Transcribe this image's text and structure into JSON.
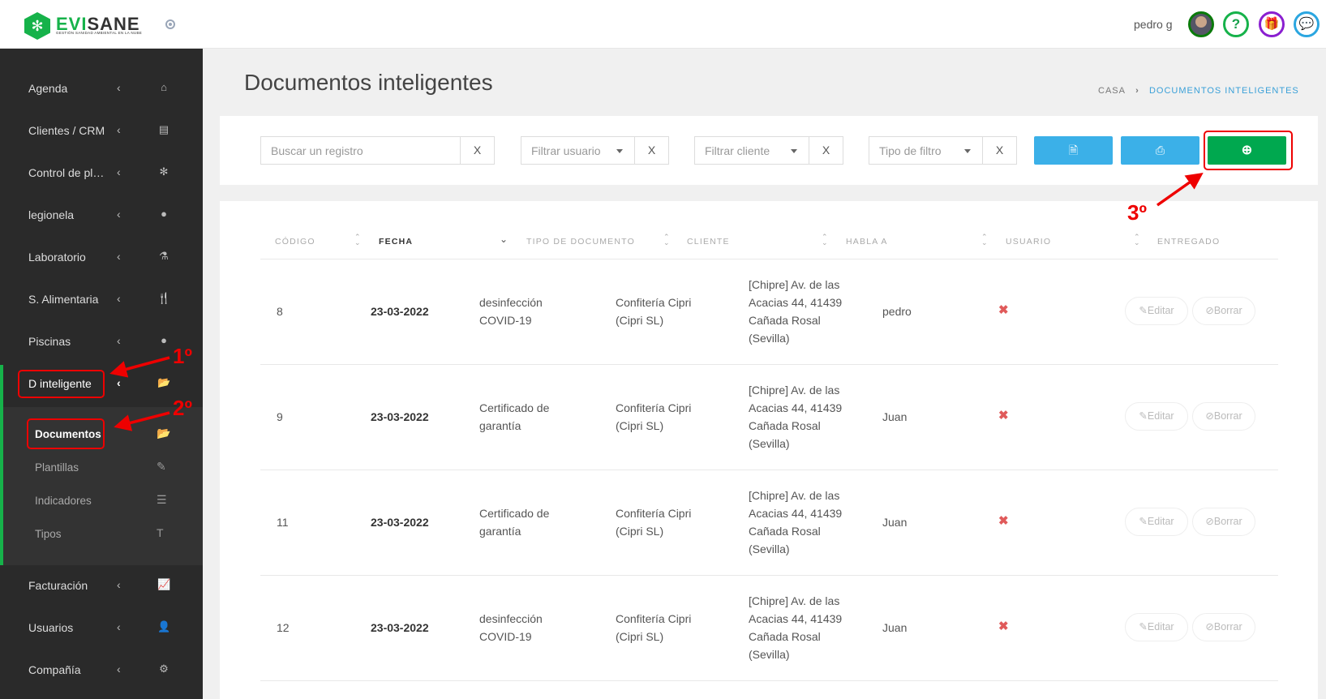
{
  "brand": {
    "name_green": "EVI",
    "name_dark": "SANE",
    "tagline": "GESTIÓN SANIDAD AMBIENTAL EN LA NUBE"
  },
  "topbar": {
    "username": "pedro g",
    "icons": [
      "avatar",
      "help-icon",
      "gift-icon",
      "chat-icon"
    ],
    "colors": {
      "help": "#16b24a",
      "gift": "#8a1fd0",
      "chat": "#2ba6e0"
    }
  },
  "sidebar": {
    "items": [
      {
        "label": "Agenda",
        "icon": "⌂"
      },
      {
        "label": "Clientes / CRM",
        "icon": "▤"
      },
      {
        "label": "Control de pl…",
        "icon": "✻"
      },
      {
        "label": "legionela",
        "icon": "●"
      },
      {
        "label": "Laboratorio",
        "icon": "⚗"
      },
      {
        "label": "S. Alimentaria",
        "icon": "🍴"
      },
      {
        "label": "Piscinas",
        "icon": "●"
      },
      {
        "label": "D inteligente",
        "icon": "📂"
      }
    ],
    "subitems": [
      {
        "label": "Documentos",
        "icon": "📂"
      },
      {
        "label": "Plantillas",
        "icon": "✎"
      },
      {
        "label": "Indicadores",
        "icon": "☰"
      },
      {
        "label": "Tipos",
        "icon": "T"
      }
    ],
    "bottom_items": [
      {
        "label": "Facturación",
        "icon": "📈"
      },
      {
        "label": "Usuarios",
        "icon": "👤"
      },
      {
        "label": "Compañía",
        "icon": "⚙"
      }
    ]
  },
  "page": {
    "title": "Documentos inteligentes",
    "breadcrumb": [
      "CASA",
      "DOCUMENTOS INTELIGENTES"
    ]
  },
  "filters": {
    "search_placeholder": "Buscar un registro",
    "user": "Filtrar usuario",
    "client": "Filtrar cliente",
    "type": "Tipo de filtro",
    "clear": "X"
  },
  "table": {
    "headers": [
      "CÓDIGO",
      "FECHA",
      "TIPO DE DOCUMENTO",
      "CLIENTE",
      "HABLA A",
      "USUARIO",
      "ENTREGADO"
    ],
    "edit_label": "Editar",
    "delete_label": "Borrar",
    "rows": [
      {
        "code": "8",
        "date": "23-03-2022",
        "type": [
          "desinfección",
          "COVID-19"
        ],
        "client": [
          "Confitería Cipri",
          "(Cipri SL)"
        ],
        "address": [
          "[Chipre] Av. de las",
          "Acacias 44, 41439",
          "Cañada Rosal",
          "(Sevilla)"
        ],
        "talk_to": "pedro",
        "delivered": "✖"
      },
      {
        "code": "9",
        "date": "23-03-2022",
        "type": [
          "Certificado de",
          "garantía"
        ],
        "client": [
          "Confitería Cipri",
          "(Cipri SL)"
        ],
        "address": [
          "[Chipre] Av. de las",
          "Acacias 44, 41439",
          "Cañada Rosal",
          "(Sevilla)"
        ],
        "talk_to": "Juan",
        "delivered": "✖"
      },
      {
        "code": "11",
        "date": "23-03-2022",
        "type": [
          "Certificado de",
          "garantía"
        ],
        "client": [
          "Confitería Cipri",
          "(Cipri SL)"
        ],
        "address": [
          "[Chipre] Av. de las",
          "Acacias 44, 41439",
          "Cañada Rosal",
          "(Sevilla)"
        ],
        "talk_to": "Juan",
        "delivered": "✖"
      },
      {
        "code": "12",
        "date": "23-03-2022",
        "type": [
          "desinfección",
          "COVID-19"
        ],
        "client": [
          "Confitería Cipri",
          "(Cipri SL)"
        ],
        "address": [
          "[Chipre] Av. de las",
          "Acacias 44, 41439",
          "Cañada Rosal",
          "(Sevilla)"
        ],
        "talk_to": "Juan",
        "delivered": "✖"
      }
    ]
  },
  "annotations": [
    "1º",
    "2º",
    "3º"
  ]
}
